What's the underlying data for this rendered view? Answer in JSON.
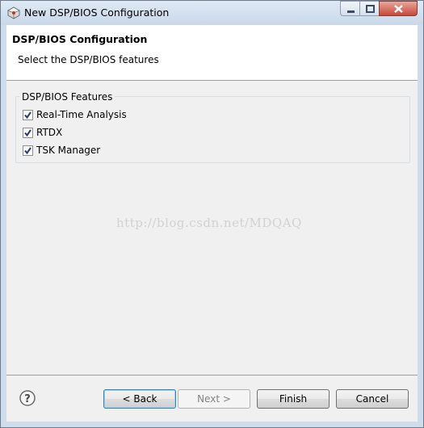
{
  "window": {
    "title": "New DSP/BIOS Configuration"
  },
  "banner": {
    "title": "DSP/BIOS Configuration",
    "subtitle": "Select the DSP/BIOS features"
  },
  "features_group": {
    "label": "DSP/BIOS Features",
    "items": [
      {
        "label": "Real-Time Analysis",
        "checked": true
      },
      {
        "label": "RTDX",
        "checked": true
      },
      {
        "label": "TSK Manager",
        "checked": true
      }
    ]
  },
  "watermark": "http://blog.csdn.net/MDQAQ",
  "footer": {
    "help_icon": "question-circle-icon",
    "back_label": "< Back",
    "next_label": "Next >",
    "finish_label": "Finish",
    "cancel_label": "Cancel"
  },
  "colors": {
    "frame": "#cfdceb",
    "client_bg": "#f0f0f0",
    "close_button": "#c7483a",
    "default_button_border": "#3c7fb1"
  }
}
